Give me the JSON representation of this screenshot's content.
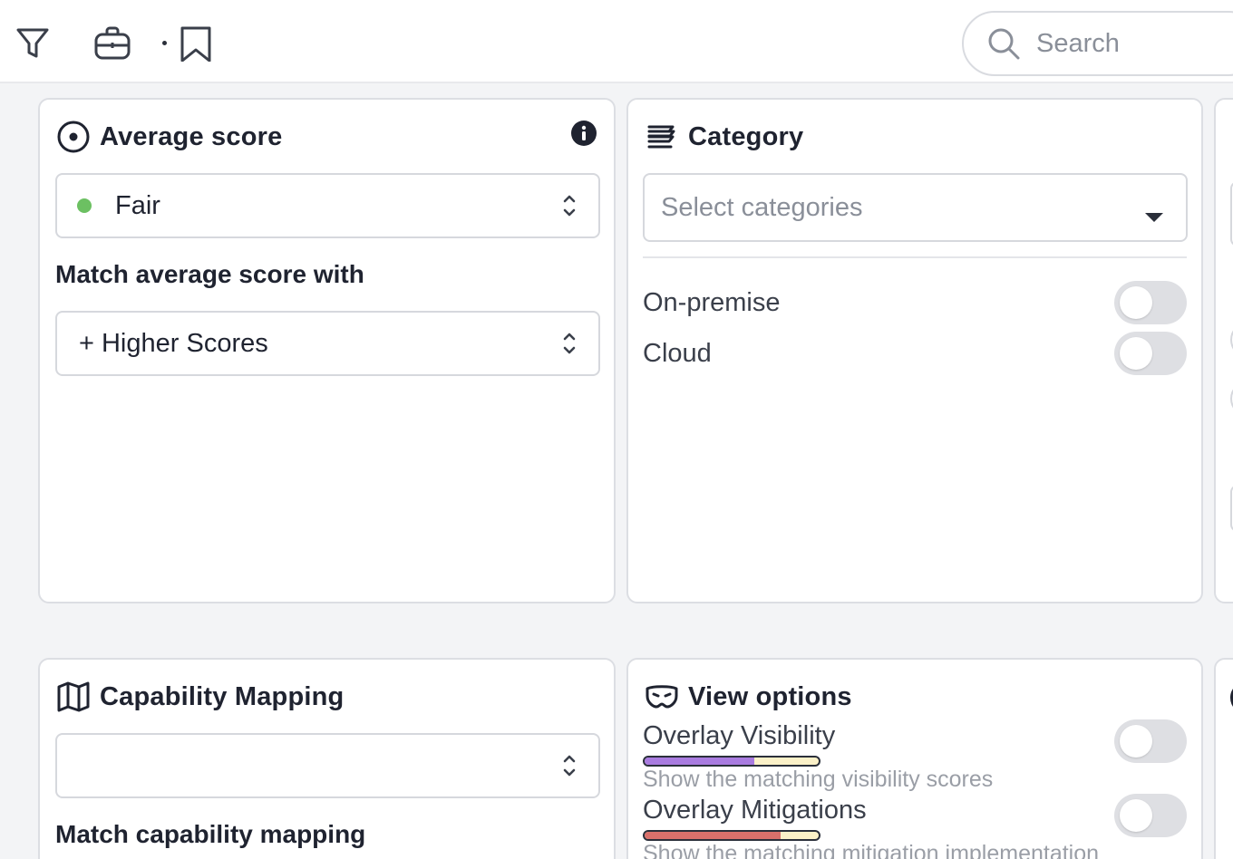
{
  "toolbar": {
    "icons": [
      "filter-icon",
      "briefcase-icon",
      "bookmark-icon"
    ],
    "search_placeholder": "Search"
  },
  "average_score": {
    "title": "Average score",
    "selected": "Fair",
    "status_color": "#6cc062",
    "match_label": "Match average score with",
    "match_value": "+ Higher Scores"
  },
  "category": {
    "title": "Category",
    "placeholder": "Select categories",
    "toggles": [
      {
        "label": "On-premise",
        "on": false
      },
      {
        "label": "Cloud",
        "on": false
      }
    ]
  },
  "capability_mapping": {
    "title": "Capability Mapping",
    "selected": "",
    "match_label": "Match capability mapping"
  },
  "view_options": {
    "title": "View options",
    "overlays": [
      {
        "title": "Overlay Visibility",
        "subtitle": "Show the matching visibility scores",
        "bar_color": "#a97be0",
        "fill_fraction": 0.63,
        "on": false
      },
      {
        "title": "Overlay Mitigations",
        "subtitle": "Show the matching mitigation implementation",
        "bar_color": "#d9706b",
        "fill_fraction": 0.78,
        "on": false
      }
    ]
  },
  "colors": {
    "accent_dark": "#1f2330",
    "muted": "#9a9ea6",
    "toggle_off": "#dedfe3"
  }
}
